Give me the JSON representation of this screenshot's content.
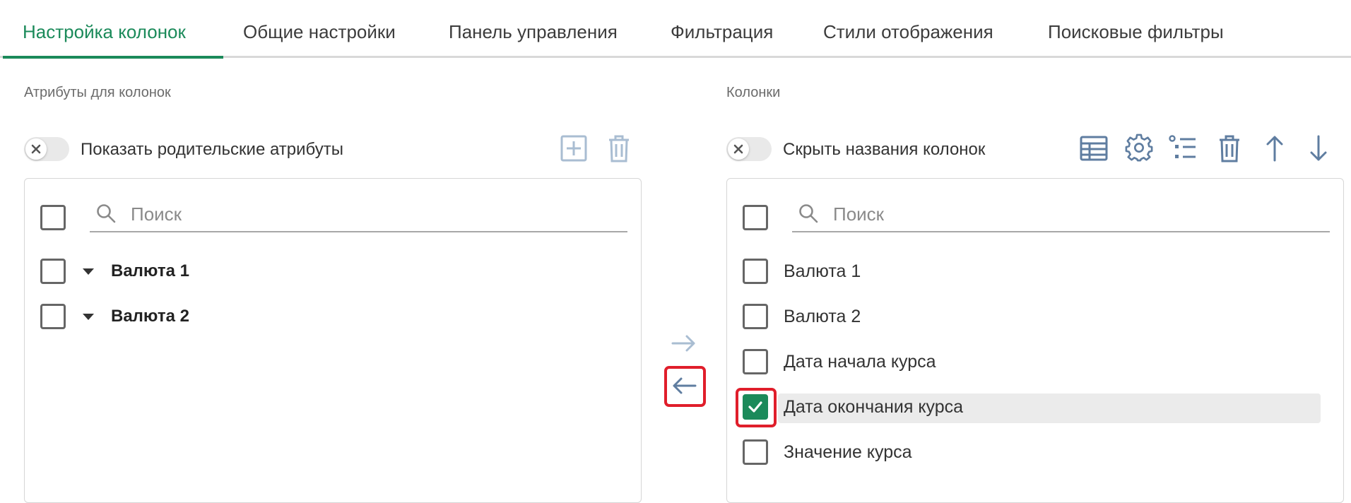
{
  "tabs": [
    {
      "label": "Настройка колонок",
      "active": true
    },
    {
      "label": "Общие настройки",
      "active": false
    },
    {
      "label": "Панель управления",
      "active": false
    },
    {
      "label": "Фильтрация",
      "active": false
    },
    {
      "label": "Стили отображения",
      "active": false
    },
    {
      "label": "Поисковые фильтры",
      "active": false
    }
  ],
  "left": {
    "section_label": "Атрибуты для колонок",
    "toggle_label": "Показать родительские атрибуты",
    "toggle_on": false,
    "toolbar_icons": [
      "plus-box-icon",
      "trash-icon"
    ],
    "search_placeholder": "Поиск",
    "items": [
      {
        "label": "Валюта 1",
        "checked": false,
        "expandable": true
      },
      {
        "label": "Валюта 2",
        "checked": false,
        "expandable": true
      }
    ]
  },
  "transfer": {
    "icons": [
      "arrow-right-icon",
      "arrow-left-icon"
    ],
    "highlighted": "arrow-left-icon"
  },
  "right": {
    "section_label": "Колонки",
    "toggle_label": "Скрыть названия колонок",
    "toggle_on": false,
    "toolbar_icons": [
      "table-icon",
      "gear-icon",
      "list-settings-icon",
      "trash-icon",
      "arrow-up-icon",
      "arrow-down-icon"
    ],
    "search_placeholder": "Поиск",
    "items": [
      {
        "label": "Валюта 1",
        "checked": false
      },
      {
        "label": "Валюта 2",
        "checked": false
      },
      {
        "label": "Дата начала курса",
        "checked": false
      },
      {
        "label": "Дата окончания курса",
        "checked": true
      },
      {
        "label": "Значение курса",
        "checked": false
      }
    ]
  },
  "colors": {
    "accent": "#1b8a5a",
    "highlight_frame": "#e01e2b",
    "selected_row_bg": "#ebebeb"
  }
}
